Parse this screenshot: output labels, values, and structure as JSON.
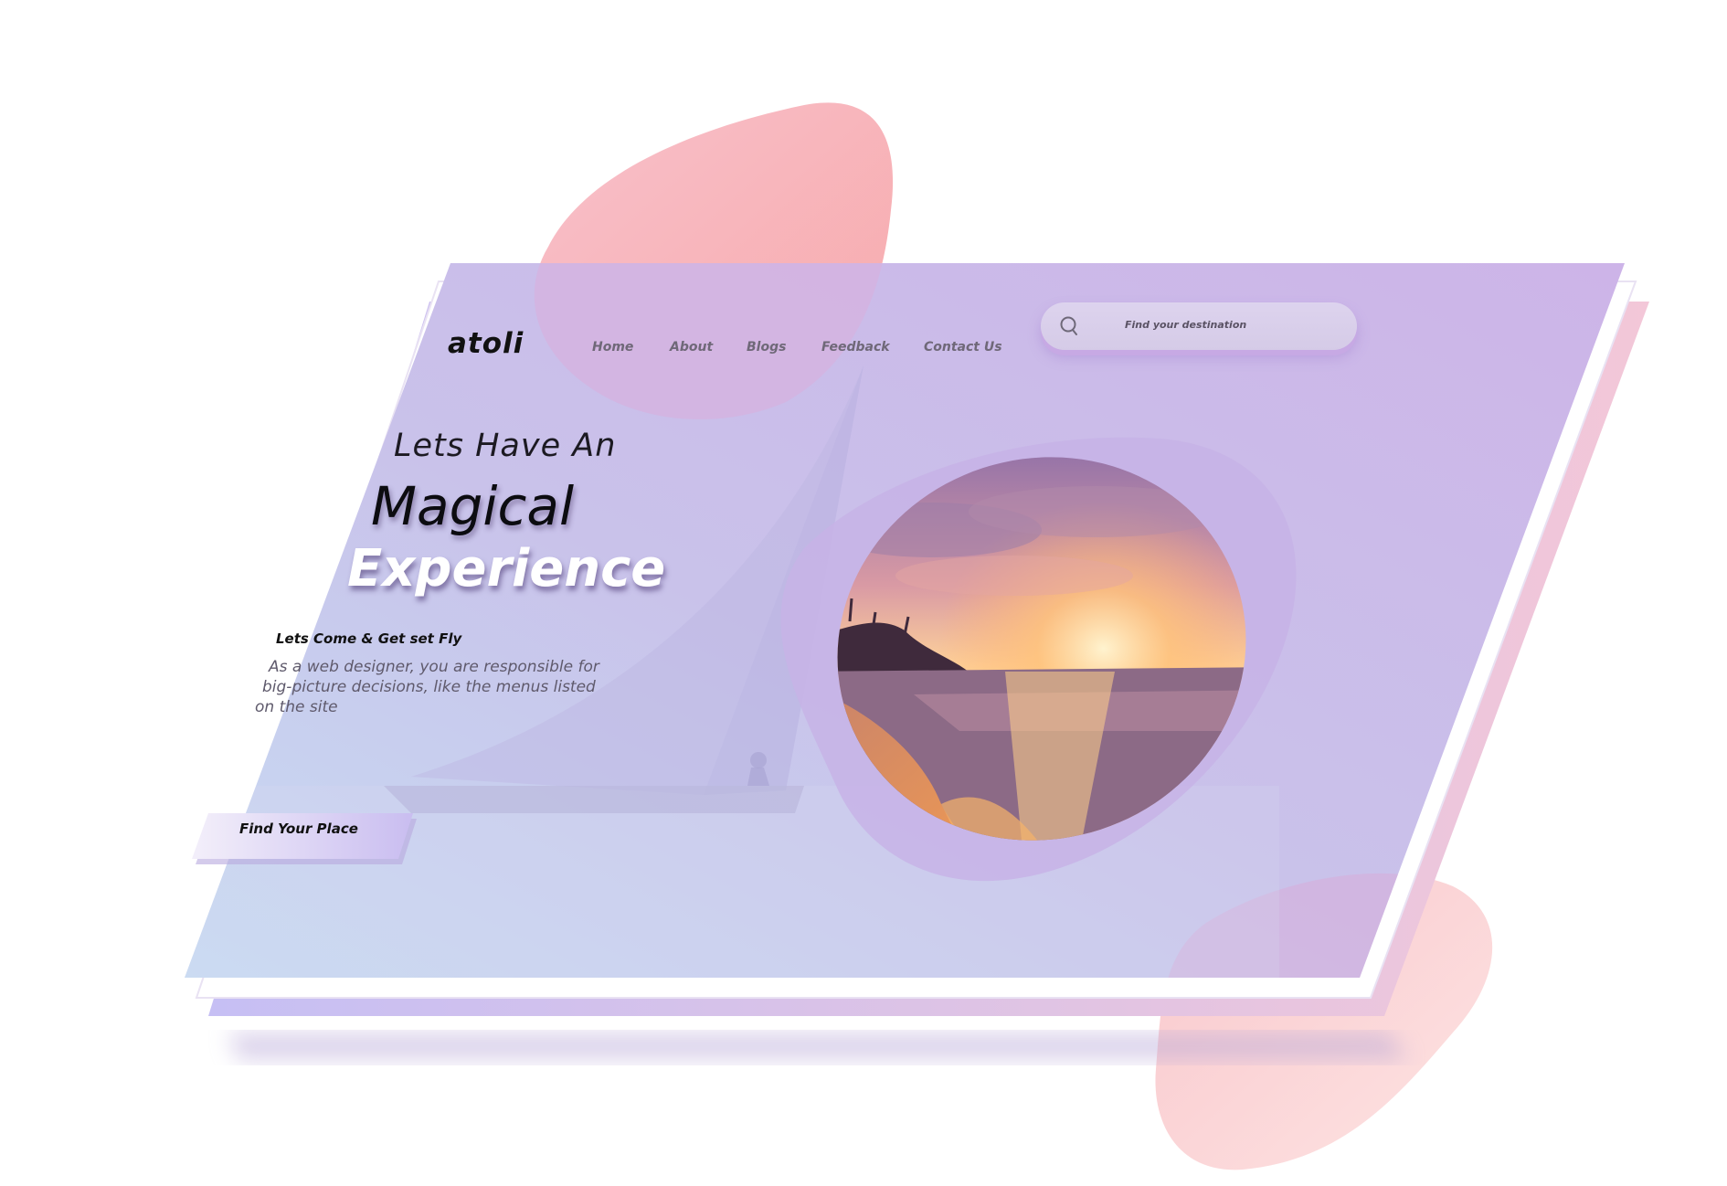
{
  "brand": {
    "logo": "atoli"
  },
  "nav": {
    "items": [
      {
        "label": "Home"
      },
      {
        "label": "About"
      },
      {
        "label": "Blogs"
      },
      {
        "label": "Feedback"
      },
      {
        "label": "Contact Us"
      }
    ]
  },
  "search": {
    "placeholder": "Find your destination",
    "icon": "search-icon"
  },
  "hero": {
    "line1": "Lets Have An",
    "line2": "Magical",
    "line3": "Experience",
    "tagline": "Lets Come & Get set Fly",
    "description_lines": [
      "As a web designer, you are responsible for",
      "big-picture decisions, like the menus listed",
      "on the site"
    ]
  },
  "cta": {
    "label": "Find Your Place"
  },
  "colors": {
    "panel_left": "#c9d6f2",
    "panel_right": "#c9b2e8",
    "blob_pink": "#f7a9ad",
    "back_card": "#cdbdf1",
    "sunset_orange": "#f2a35b",
    "text_dark": "#111111"
  }
}
